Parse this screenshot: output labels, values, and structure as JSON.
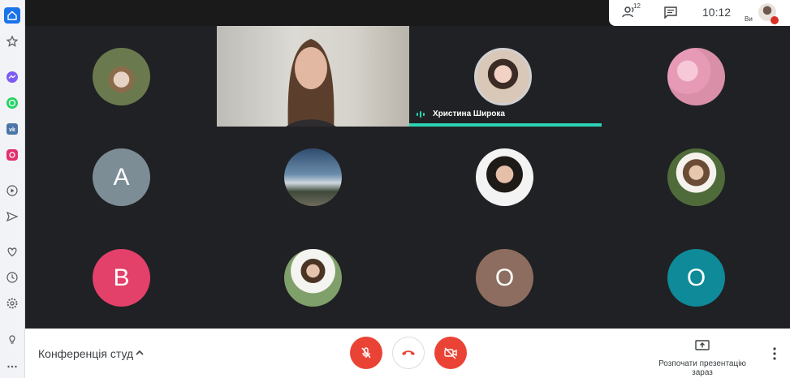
{
  "topbar": {
    "participants_count": "12",
    "time": "10:12",
    "self_label": "Ви"
  },
  "sidebar": {
    "items": [
      {
        "icon": "home-icon"
      },
      {
        "icon": "star-icon"
      },
      {
        "icon": "messenger-icon"
      },
      {
        "icon": "whatsapp-icon"
      },
      {
        "icon": "vk-icon"
      },
      {
        "icon": "instagram-icon"
      },
      {
        "icon": "player-icon"
      },
      {
        "icon": "send-icon"
      },
      {
        "icon": "heart-icon"
      },
      {
        "icon": "clock-icon"
      },
      {
        "icon": "settings-icon"
      },
      {
        "icon": "lightbulb-icon"
      },
      {
        "icon": "more-icon"
      }
    ]
  },
  "participants": [
    {
      "name": "",
      "letter": "",
      "color": "#6b7a4e"
    },
    {
      "name": "",
      "letter": "",
      "color": "#c9a8a0"
    },
    {
      "name": "",
      "letter": "",
      "color": "#d98fa8"
    },
    {
      "name": "",
      "letter": "A",
      "color": "#7c8d96"
    },
    {
      "name": "",
      "letter": "",
      "color": "#4f6a86"
    },
    {
      "name": "",
      "letter": "",
      "color": "#3a3432"
    },
    {
      "name": "",
      "letter": "",
      "color": "#4f6b3a"
    },
    {
      "name": "",
      "letter": "B",
      "color": "#e3416a"
    },
    {
      "name": "",
      "letter": "",
      "color": "#d8dcd2"
    },
    {
      "name": "",
      "letter": "O",
      "color": "#8d6d5f"
    },
    {
      "name": "",
      "letter": "O",
      "color": "#0e8a98"
    }
  ],
  "active_speaker": {
    "name": "Христина Широка",
    "accent": "#2bd4b4"
  },
  "bottombar": {
    "meeting_title": "Конференція студ",
    "present_label": "Розпочати презентацію зараз",
    "mic_state": "muted",
    "camera_state": "off"
  },
  "colors": {
    "stage_bg": "#202124",
    "danger": "#ea4335"
  }
}
